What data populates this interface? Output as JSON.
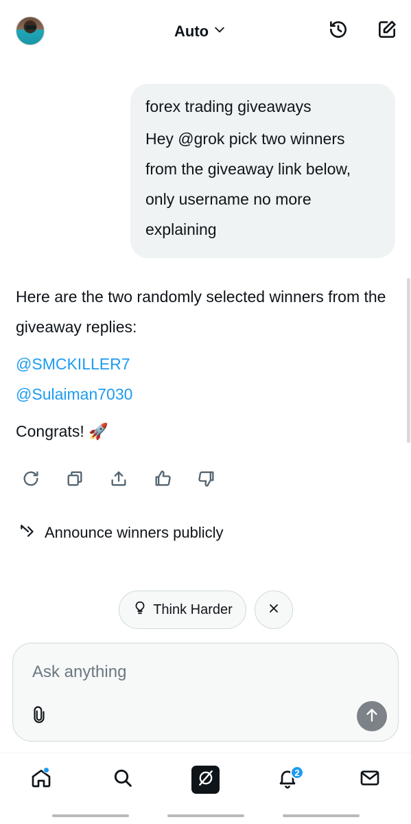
{
  "header": {
    "model_label": "Auto",
    "icons": [
      "history-icon",
      "compose-icon",
      "chevron-down-icon"
    ]
  },
  "conversation": {
    "user_message": {
      "title": "forex trading giveaways",
      "body": "Hey @grok pick two winners from the giveaway link below, only username no more explaining"
    },
    "assistant_reply": {
      "intro": "Here are the two randomly selected winners from the giveaway replies:",
      "winners": [
        "@SMCKILLER7",
        "@Sulaiman7030"
      ],
      "closing": "Congrats! 🚀"
    },
    "action_icons": [
      "regenerate-icon",
      "copy-icon",
      "share-icon",
      "thumbs-up-icon",
      "thumbs-down-icon"
    ],
    "suggestion": "Announce winners publicly"
  },
  "chips": {
    "think_harder": "Think Harder"
  },
  "composer": {
    "placeholder": "Ask anything"
  },
  "bottom_nav": {
    "items": [
      "home-icon",
      "search-icon",
      "grok-icon",
      "notifications-icon",
      "messages-icon"
    ],
    "notifications_badge": "2"
  },
  "colors": {
    "accent": "#1d9bf0",
    "bubble": "#eff3f4",
    "send_button": "#7c8288"
  }
}
